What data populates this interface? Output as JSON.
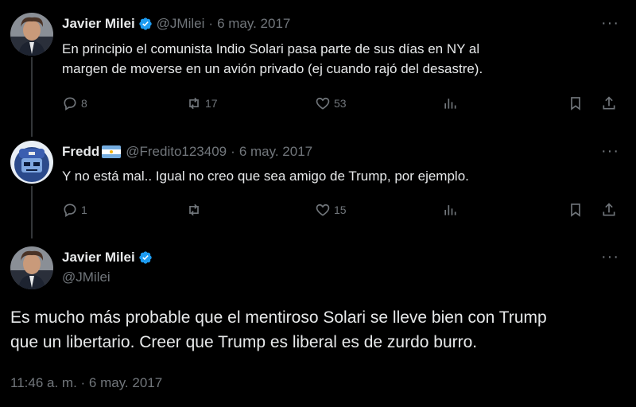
{
  "tweets": [
    {
      "name": "Javier Milei",
      "handle": "@JMilei",
      "dot": "·",
      "date": "6 may. 2017",
      "text_lines": [
        "En principio el comunista Indio Solari pasa parte de sus días en NY al",
        "margen de moverse en un avión privado (ej cuando rajó del desastre)."
      ],
      "replies": "8",
      "retweets": "17",
      "likes": "53"
    },
    {
      "name": "Fredd",
      "handle": "@Fredito123409",
      "dot": "·",
      "date": "6 may. 2017",
      "text_lines": [
        "Y no está mal.. Igual no creo que sea amigo de Trump, por ejemplo."
      ],
      "replies": "1",
      "retweets": "",
      "likes": "15"
    }
  ],
  "main_tweet": {
    "name": "Javier Milei",
    "handle": "@JMilei",
    "text_lines": [
      "Es mucho más probable que el mentiroso Solari se lleve bien con Trump",
      "que un libertario. Creer que Trump es liberal es de zurdo burro."
    ],
    "timestamp": "11:46 a. m. · 6 may. 2017"
  },
  "colors": {
    "background": "#000000",
    "text": "#e7e9ea",
    "muted": "#71767b",
    "verified": "#1d9bf0"
  },
  "icons": [
    "reply-icon",
    "retweet-icon",
    "like-icon",
    "views-icon",
    "bookmark-icon",
    "share-icon",
    "more-icon",
    "verified-badge-icon",
    "argentina-flag-icon"
  ]
}
